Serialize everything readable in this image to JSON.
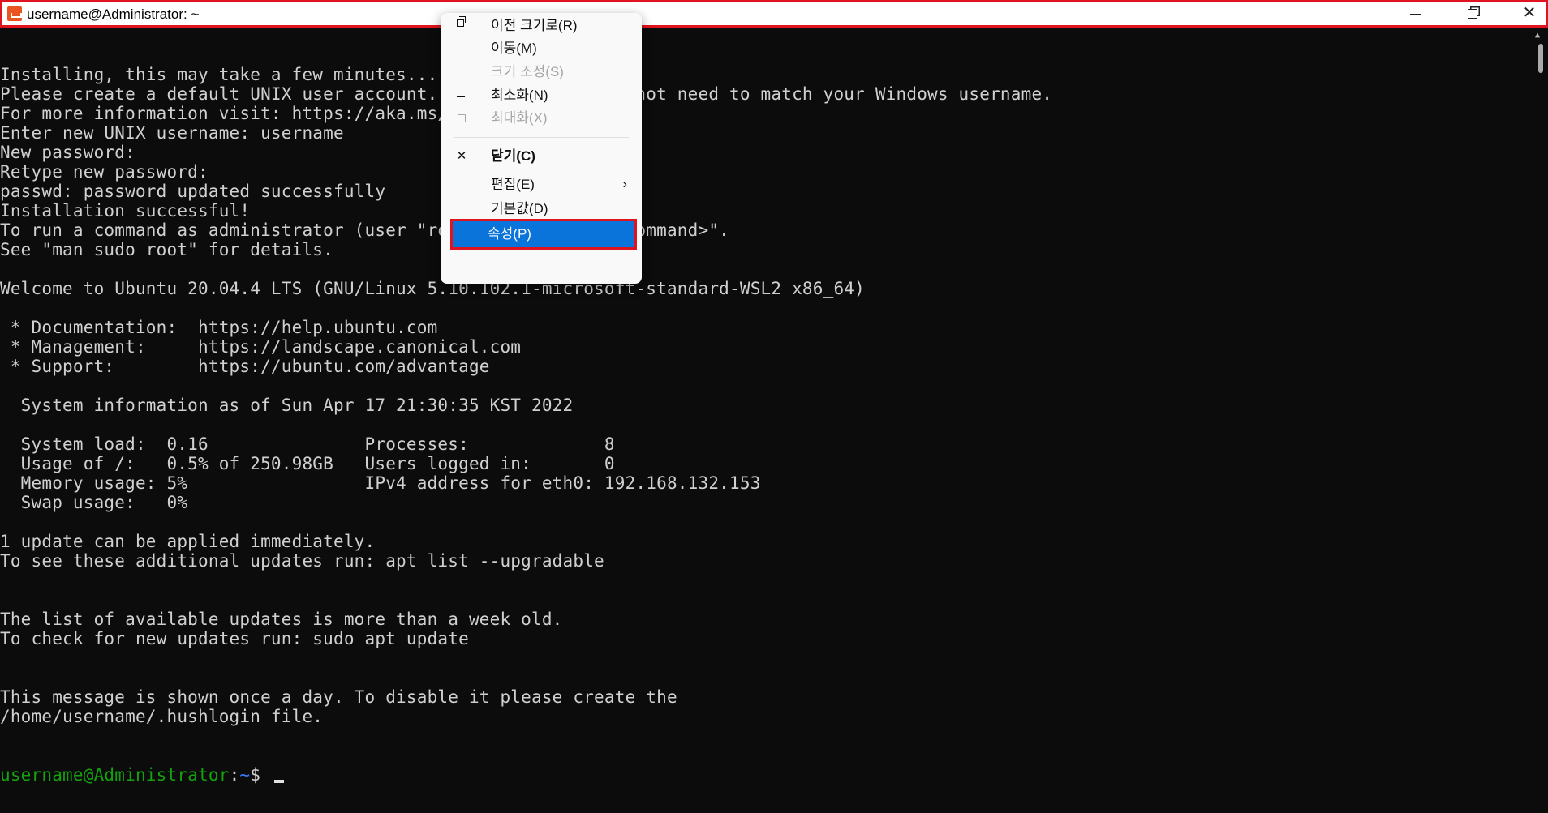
{
  "window": {
    "title": "username@Administrator: ~",
    "minimize_glyph": "—",
    "close_glyph": "✕"
  },
  "terminal": {
    "lines": [
      "Installing, this may take a few minutes...",
      "Please create a default UNIX user account. The username does not need to match your Windows username.",
      "For more information visit: https://aka.ms/wslusers",
      "Enter new UNIX username: username",
      "New password:",
      "Retype new password:",
      "passwd: password updated successfully",
      "Installation successful!",
      "To run a command as administrator (user \"root\"), use \"sudo <command>\".",
      "See \"man sudo_root\" for details.",
      "",
      "Welcome to Ubuntu 20.04.4 LTS (GNU/Linux 5.10.102.1-microsoft-standard-WSL2 x86_64)",
      "",
      " * Documentation:  https://help.ubuntu.com",
      " * Management:     https://landscape.canonical.com",
      " * Support:        https://ubuntu.com/advantage",
      "",
      "  System information as of Sun Apr 17 21:30:35 KST 2022",
      "",
      "  System load:  0.16               Processes:             8",
      "  Usage of /:   0.5% of 250.98GB   Users logged in:       0",
      "  Memory usage: 5%                 IPv4 address for eth0: 192.168.132.153",
      "  Swap usage:   0%",
      "",
      "1 update can be applied immediately.",
      "To see these additional updates run: apt list --upgradable",
      "",
      "",
      "The list of available updates is more than a week old.",
      "To check for new updates run: sudo apt update",
      "",
      "",
      "This message is shown once a day. To disable it please create the",
      "/home/username/.hushlogin file."
    ],
    "prompt": {
      "user_host": "username@Administrator",
      "colon": ":",
      "path": "~",
      "symbol": "$ "
    },
    "colors": {
      "background": "#0c0c0c",
      "text": "#d0d0d0",
      "prompt_user": "#13a10e",
      "prompt_path": "#3b78ff"
    }
  },
  "context_menu": {
    "items": [
      {
        "label": "이전 크기로(R)",
        "icon": "restore-icon",
        "disabled": false
      },
      {
        "label": "이동(M)",
        "icon": "",
        "disabled": false
      },
      {
        "label": "크기 조정(S)",
        "icon": "",
        "disabled": true
      },
      {
        "label": "최소화(N)",
        "icon": "minimize-icon",
        "disabled": false
      },
      {
        "label": "최대화(X)",
        "icon": "maximize-icon",
        "disabled": true
      },
      {
        "label": "닫기(C)",
        "icon": "close-icon",
        "glyph": "✕",
        "disabled": false
      },
      {
        "label": "편집(E)",
        "icon": "",
        "disabled": false,
        "arrow": "›"
      },
      {
        "label": "기본값(D)",
        "icon": "",
        "disabled": false
      },
      {
        "label": "속성(P)",
        "icon": "",
        "disabled": false,
        "selected": true
      }
    ],
    "accent": "#0a74da",
    "highlight_border": "#e0141e"
  }
}
